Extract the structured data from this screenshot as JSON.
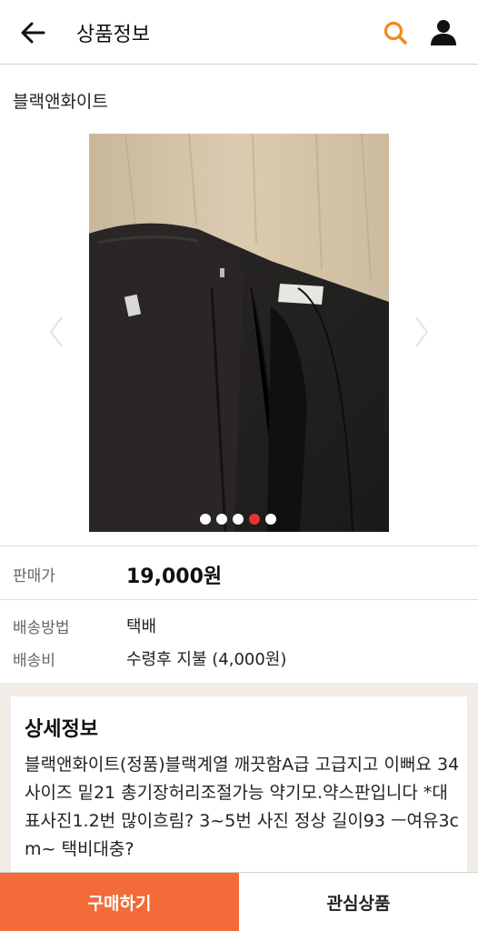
{
  "header": {
    "title": "상품정보",
    "accent_color": "#f5871f"
  },
  "product": {
    "name": "블랙앤화이트",
    "image_count": 5,
    "active_image_index": 3
  },
  "price": {
    "label": "판매가",
    "value": "19,000원"
  },
  "shipping": {
    "method_label": "배송방법",
    "method_value": "택배",
    "fee_label": "배송비",
    "fee_value": "수령후 지불 (4,000원)"
  },
  "detail": {
    "heading": "상세정보",
    "text": "블랙앤화이트(정품)블랙계열 깨끗함A급 고급지고 이뻐요 34사이즈 밑21 총기장허리조절가능 약기모.약스판입니다 *대표사진1.2번 많이흐림? 3~5번 사진 정상 길이93 ㅡ여유3cm~ 택비대충?"
  },
  "actions": {
    "buy_label": "구매하기",
    "wishlist_label": "관심상품",
    "buy_color": "#f26b38"
  }
}
